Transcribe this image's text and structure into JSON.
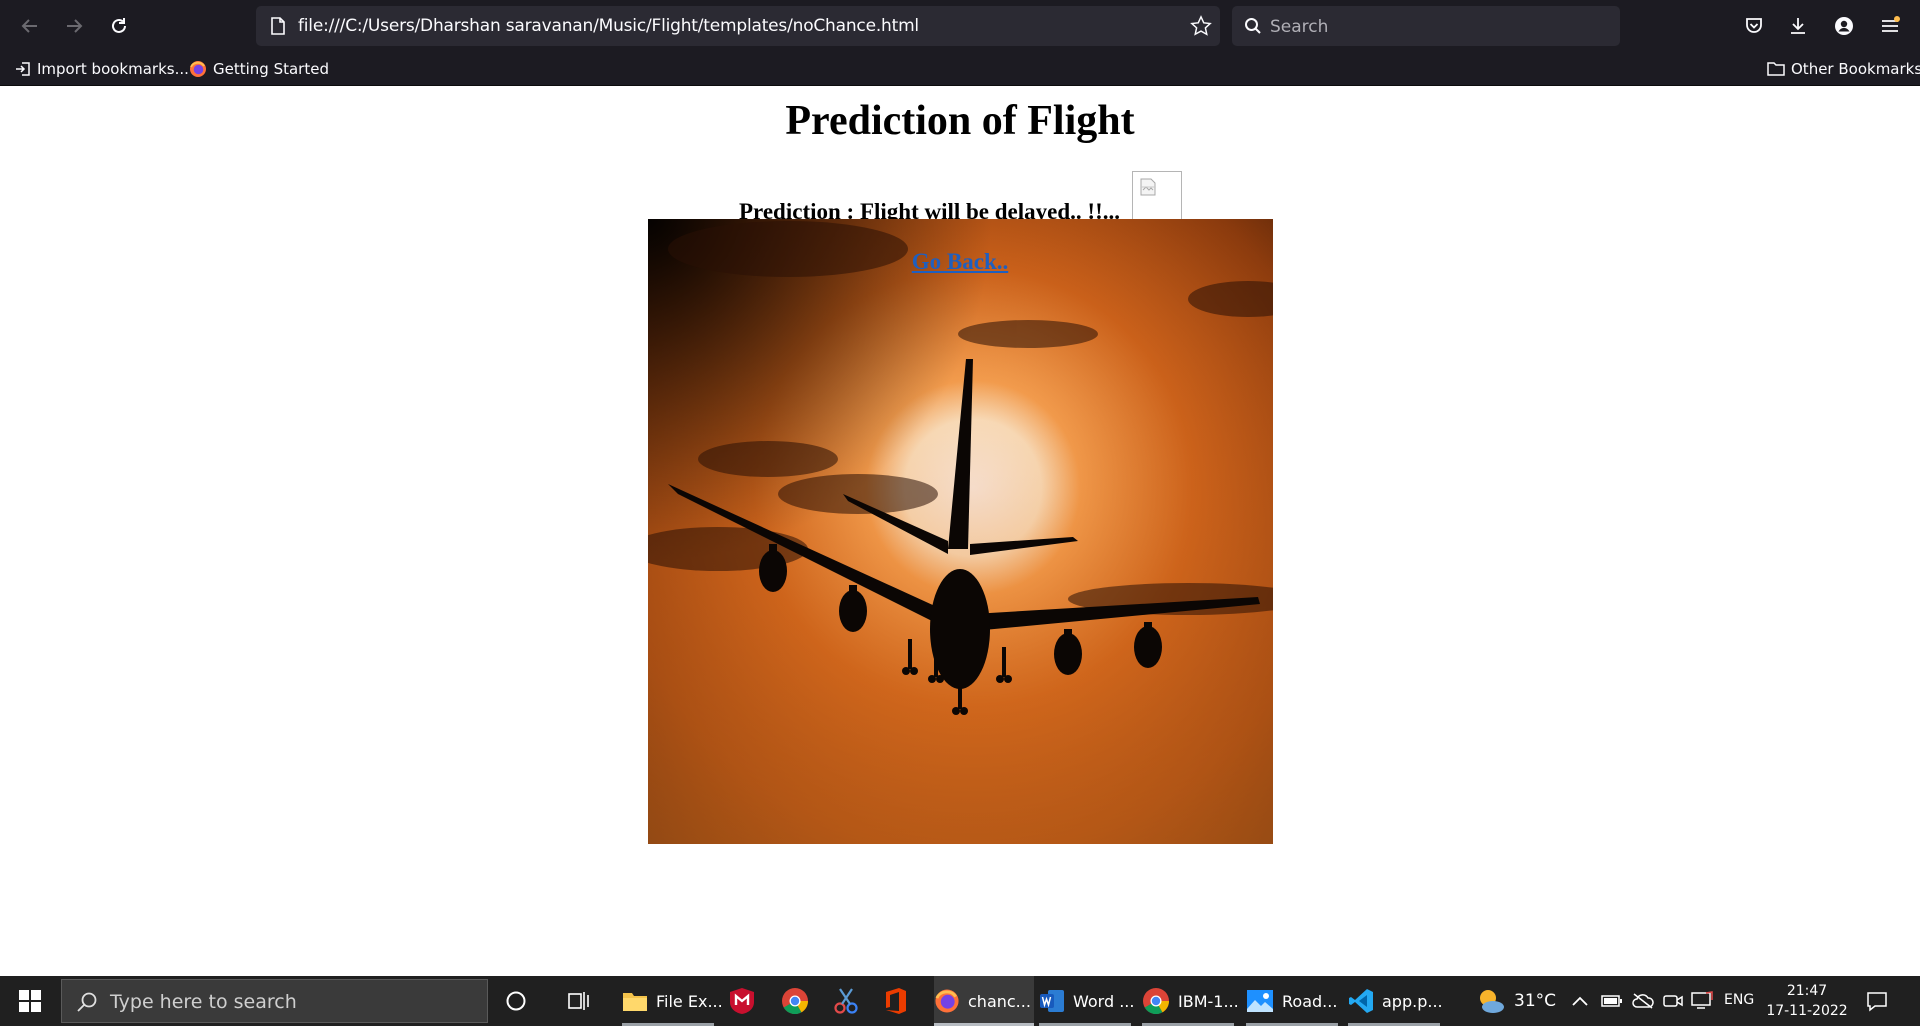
{
  "browser": {
    "url": "file:///C:/Users/Dharshan saravanan/Music/Flight/templates/noChance.html",
    "search_placeholder": "Search",
    "bookmarks": {
      "import_label": "Import bookmarks...",
      "getting_started_label": "Getting Started",
      "other_label": "Other Bookmarks"
    }
  },
  "page": {
    "title": "Prediction of Flight",
    "prediction_label": "Prediction : ",
    "prediction_value": "Flight will be delayed..",
    "prediction_suffix": " !!...",
    "go_back": "Go Back.."
  },
  "taskbar": {
    "search_placeholder": "Type here to search",
    "apps": [
      {
        "label": "File Ex..."
      },
      {
        "label": "chanc..."
      },
      {
        "label": "Word ..."
      },
      {
        "label": "IBM-1..."
      },
      {
        "label": "Road..."
      },
      {
        "label": "app.p..."
      }
    ],
    "weather": "31°C",
    "language": "ENG",
    "time": "21:47",
    "date": "17-11-2022"
  },
  "colors": {
    "chrome_bg": "#1c1b22",
    "field_bg": "#2b2a33",
    "link": "#1f5fbf",
    "taskbar_bg": "#202020"
  }
}
